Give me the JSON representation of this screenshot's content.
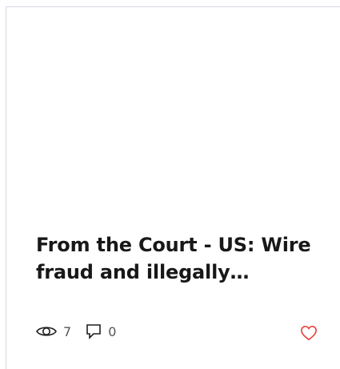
{
  "post": {
    "title": "From the Court - US: Wire fraud and illegally…",
    "views": "7",
    "comments": "0"
  },
  "icons": {
    "views": "eye-icon",
    "comments": "comment-icon",
    "like": "heart-icon"
  },
  "colors": {
    "title": "#181818",
    "meta": "#555555",
    "like": "#e8413b",
    "border": "#d7d7e6"
  }
}
